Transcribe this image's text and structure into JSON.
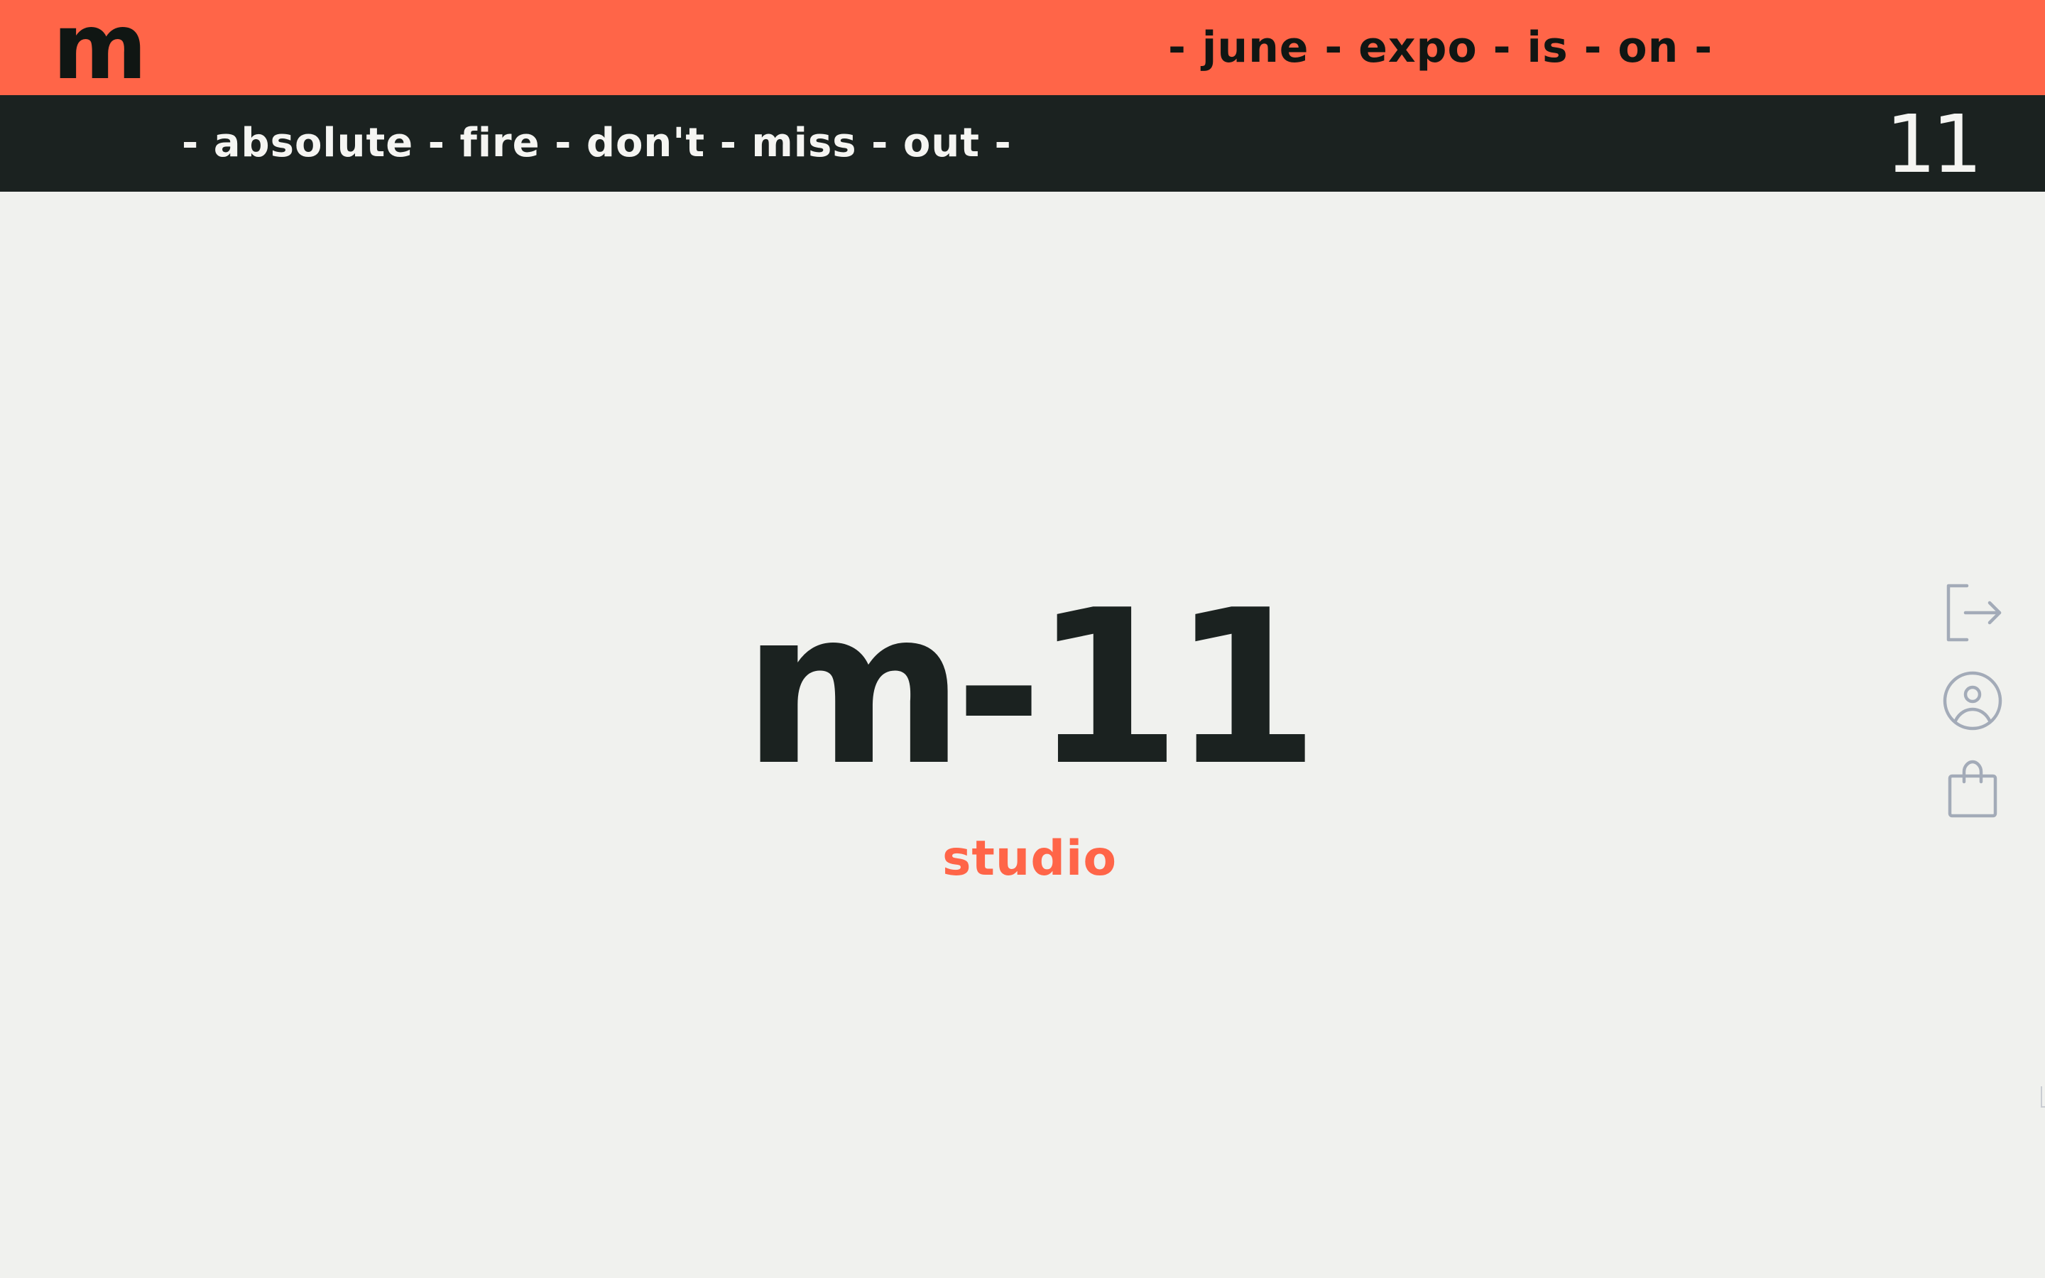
{
  "header": {
    "logo": "m",
    "ticker_top": "- june - expo - is - on -",
    "ticker_bottom": "- absolute - fire - don't - miss - out -",
    "counter": "11"
  },
  "hero": {
    "title": "m-11",
    "subtitle": "studio"
  },
  "side_nav": {
    "icons": [
      "logout-icon",
      "user-account-icon",
      "shopping-bag-icon"
    ]
  },
  "colors": {
    "accent": "#ff6548",
    "dark": "#1b2220",
    "background": "#f0f1ee",
    "icon": "#a3abb8"
  }
}
